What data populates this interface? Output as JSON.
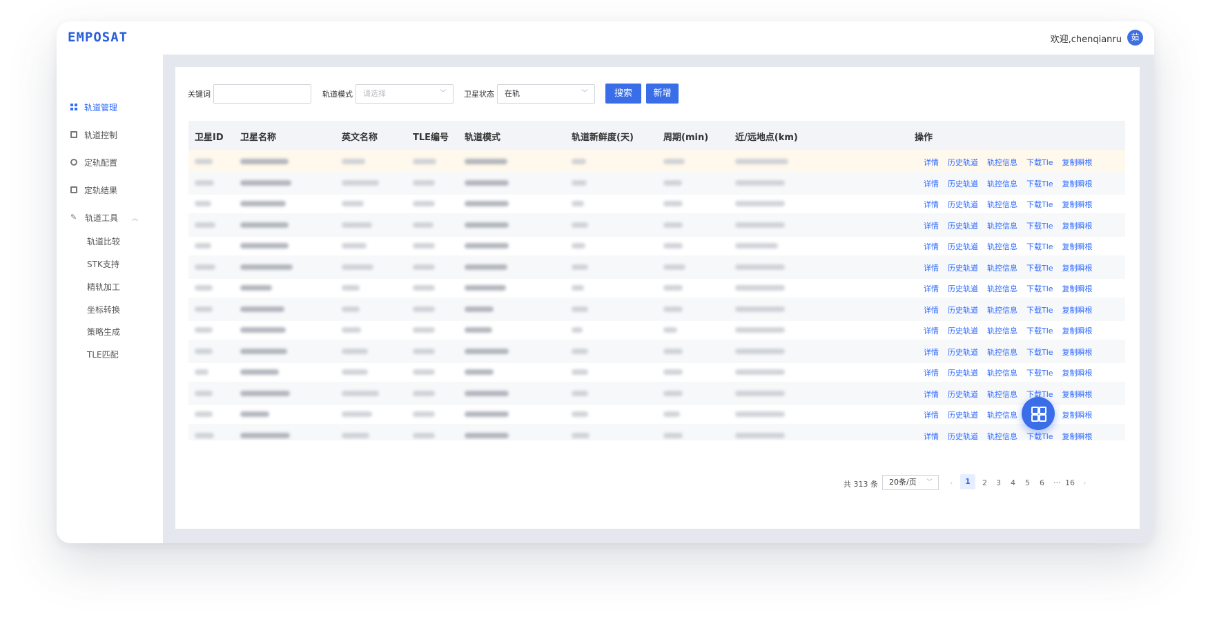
{
  "topbar": {
    "logo": "EMPOSAT",
    "welcome": "欢迎,chenqianru",
    "avatar_text": "茹"
  },
  "sidebar": {
    "items": [
      {
        "label": "轨道管理",
        "icon": "grid-icon",
        "active": true
      },
      {
        "label": "轨道控制",
        "icon": "document-icon"
      },
      {
        "label": "定轨配置",
        "icon": "gear-icon"
      },
      {
        "label": "定轨结果",
        "icon": "document-icon"
      },
      {
        "label": "轨道工具",
        "icon": "tool-icon",
        "expanded": true
      }
    ],
    "subitems": [
      "轨道比较",
      "STK支持",
      "精轨加工",
      "坐标转换",
      "策略生成",
      "TLE匹配"
    ],
    "expand_icon": "chevron-up-icon"
  },
  "filters": {
    "keyword_label": "关键词",
    "keyword_value": "",
    "mode_label": "轨道模式",
    "mode_placeholder": "请选择",
    "status_label": "卫星状态",
    "status_value": "在轨",
    "search_button": "搜索",
    "add_button": "新增"
  },
  "table": {
    "columns": [
      "卫星ID",
      "卫星名称",
      "英文名称",
      "TLE编号",
      "轨道模式",
      "轨道新鲜度(天)",
      "周期(min)",
      "近/远地点(km)",
      "操作"
    ],
    "actions": [
      "详情",
      "历史轨道",
      "轨控信息",
      "下载Tle",
      "复制瞬根"
    ],
    "row_count": 14
  },
  "pagination": {
    "total": "共 313 条",
    "page_size": "20条/页",
    "pages": [
      "1",
      "2",
      "3",
      "4",
      "5",
      "6",
      "···",
      "16"
    ],
    "prev": "‹",
    "next": "›",
    "current": "1"
  }
}
